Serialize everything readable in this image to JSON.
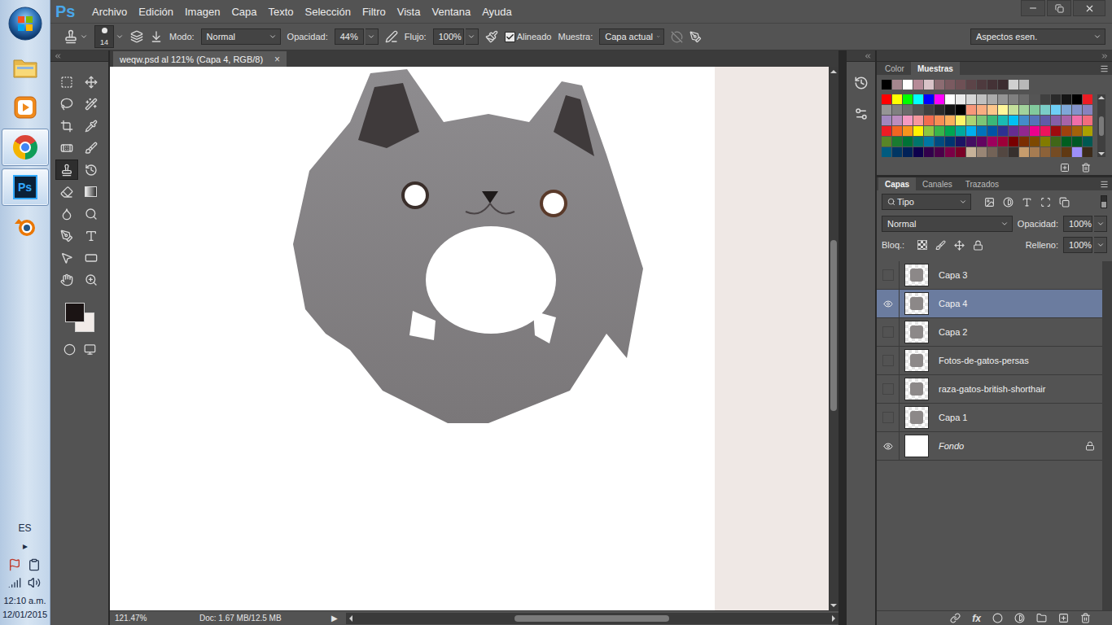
{
  "taskbar": {
    "apps": [
      {
        "kind": "explorer",
        "active": false
      },
      {
        "kind": "media",
        "active": false
      },
      {
        "kind": "chrome",
        "active": true
      },
      {
        "kind": "photoshop",
        "label": "Ps",
        "active": true
      },
      {
        "kind": "blender",
        "active": false
      }
    ],
    "language": "ES",
    "tray_toggle": "▸",
    "time": "12:10 a.m.",
    "date": "12/01/2015"
  },
  "menubar": {
    "logo": "Ps",
    "items": [
      "Archivo",
      "Edición",
      "Imagen",
      "Capa",
      "Texto",
      "Selección",
      "Filtro",
      "Vista",
      "Ventana",
      "Ayuda"
    ]
  },
  "options": {
    "brush_size": "14",
    "mode_label": "Modo:",
    "mode": "Normal",
    "opacity_label": "Opacidad:",
    "opacity": "44%",
    "flow_label": "Flujo:",
    "flow": "100%",
    "aligned": {
      "label": "Alineado",
      "checked": true
    },
    "sample_label": "Muestra:",
    "sample": "Capa actual",
    "workspace": "Aspectos esen."
  },
  "tools": [
    {
      "kind": "marquee",
      "selected": false
    },
    {
      "kind": "move",
      "selected": false
    },
    {
      "kind": "lasso",
      "selected": false
    },
    {
      "kind": "wand",
      "selected": false
    },
    {
      "kind": "crop",
      "selected": false
    },
    {
      "kind": "eyedropper",
      "selected": false
    },
    {
      "kind": "healing",
      "selected": false
    },
    {
      "kind": "brush",
      "selected": false
    },
    {
      "kind": "stamp",
      "selected": true
    },
    {
      "kind": "history",
      "selected": false
    },
    {
      "kind": "eraser",
      "selected": false
    },
    {
      "kind": "gradient",
      "selected": false
    },
    {
      "kind": "blur",
      "selected": false
    },
    {
      "kind": "dodge",
      "selected": false
    },
    {
      "kind": "pen",
      "selected": false
    },
    {
      "kind": "type",
      "selected": false
    },
    {
      "kind": "path",
      "selected": false
    },
    {
      "kind": "shape",
      "selected": false
    },
    {
      "kind": "hand",
      "selected": false
    },
    {
      "kind": "zoom",
      "selected": false
    }
  ],
  "colors": {
    "foreground": "#1b1414",
    "background": "#f1ebe8"
  },
  "document": {
    "tab": "weqw.psd al 121% (Capa 4, RGB/8)",
    "close": "×",
    "zoom": "121.47%",
    "info": "Doc: 1.67 MB/12.5 MB",
    "info_menu": "▶"
  },
  "swatches_panel": {
    "tabs": [
      {
        "label": "Color",
        "selected": false
      },
      {
        "label": "Muestras",
        "selected": true
      }
    ],
    "recent": [
      "#000000",
      "#a4868e",
      "#ffffff",
      "#b58a97",
      "#d9c3c8",
      "#8c6c72",
      "#7a5a60",
      "#6e5055",
      "#5c4448",
      "#4e3a3e",
      "#443236",
      "#3c2c30",
      "#d0d0d0",
      "#b8b8b8"
    ],
    "grid": [
      "#ff0000",
      "#ffff00",
      "#00ff00",
      "#00ffff",
      "#0000ff",
      "#ff00ff",
      "#ffffff",
      "#ebebeb",
      "#d6d6d6",
      "#c0c0c0",
      "#ababab",
      "#959595",
      "#808080",
      "#6b6b6b",
      "#555555",
      "#404040",
      "#2b2b2b",
      "#151515",
      "#000000",
      "#ed1c24",
      "#959595",
      "#808080",
      "#6b6b6b",
      "#555555",
      "#404040",
      "#2b2b2b",
      "#151515",
      "#000000",
      "#f7977a",
      "#f9ad81",
      "#fdc68a",
      "#fff79a",
      "#c4df9b",
      "#a2d39c",
      "#82ca9d",
      "#7bcdc8",
      "#6ecff6",
      "#7ea7d8",
      "#8493ca",
      "#8882be",
      "#a187be",
      "#bc8dbf",
      "#f49ac2",
      "#f6989d",
      "#f26c4f",
      "#f68e55",
      "#fbaf5c",
      "#fff467",
      "#acd372",
      "#7cc576",
      "#3bb878",
      "#1abbb4",
      "#00bff3",
      "#438cca",
      "#5574b9",
      "#605ca8",
      "#855fa8",
      "#a763a8",
      "#f06ea9",
      "#f26d7d",
      "#ed1c24",
      "#f26522",
      "#f7941d",
      "#fff200",
      "#8dc73f",
      "#39b54a",
      "#00a651",
      "#00a99d",
      "#00aeef",
      "#0072bc",
      "#0054a6",
      "#2e3192",
      "#662d91",
      "#92278f",
      "#ec008c",
      "#ed145b",
      "#9e0b0f",
      "#a0410d",
      "#a3620a",
      "#aba000",
      "#598527",
      "#1a7b30",
      "#007236",
      "#00746b",
      "#0076a3",
      "#004b80",
      "#003471",
      "#1b1464",
      "#440e62",
      "#630460",
      "#9e005d",
      "#9e0039",
      "#790000",
      "#7b2e00",
      "#7d4900",
      "#827b00",
      "#406618",
      "#005e20",
      "#005826",
      "#005952",
      "#005b7f",
      "#003663",
      "#002157",
      "#0d004c",
      "#32004b",
      "#4b0049",
      "#7b0046",
      "#7a0026",
      "#c7b299",
      "#998675",
      "#736357",
      "#534741",
      "#37302d",
      "#c69c6d",
      "#a67c52",
      "#8c6239",
      "#754c24",
      "#603913",
      "#9e8ffa",
      "#3c2b1a"
    ]
  },
  "layers_panel": {
    "tabs": [
      {
        "label": "Capas",
        "selected": true
      },
      {
        "label": "Canales",
        "selected": false
      },
      {
        "label": "Trazados",
        "selected": false
      }
    ],
    "filter": "Tipo",
    "blend": "Normal",
    "opacity_label": "Opacidad:",
    "opacity": "100%",
    "lock_label": "Bloq.:",
    "fill_label": "Relleno:",
    "fill": "100%",
    "fx": "fx",
    "layers": [
      {
        "name": "Capa 3",
        "kind": "pixel",
        "visible": false,
        "selected": false,
        "locked": false
      },
      {
        "name": "Capa 4",
        "kind": "pixel",
        "visible": true,
        "selected": true,
        "locked": false
      },
      {
        "name": "Capa 2",
        "kind": "pixel",
        "visible": false,
        "selected": false,
        "locked": false
      },
      {
        "name": "Fotos-de-gatos-persas",
        "kind": "pixel",
        "visible": false,
        "selected": false,
        "locked": false
      },
      {
        "name": "raza-gatos-british-shorthair",
        "kind": "pixel",
        "visible": false,
        "selected": false,
        "locked": false
      },
      {
        "name": "Capa 1",
        "kind": "pixel",
        "visible": false,
        "selected": false,
        "locked": false
      },
      {
        "name": "Fondo",
        "kind": "background",
        "visible": true,
        "selected": false,
        "locked": true
      }
    ]
  }
}
